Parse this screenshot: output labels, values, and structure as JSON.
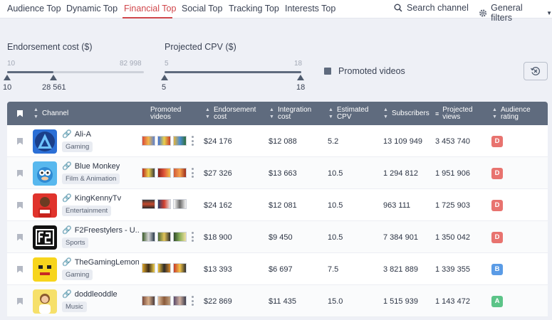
{
  "nav": {
    "tabs": [
      "Audience Top",
      "Dynamic Top",
      "Financial Top",
      "Social Top",
      "Tracking Top",
      "Interests Top"
    ],
    "active_tab": "Financial Top",
    "search_placeholder": "Search channel",
    "filters_label": "General filters"
  },
  "sliders": {
    "endorsement": {
      "title": "Endorsement cost ($)",
      "min": "10",
      "max": "82 998",
      "low": "10",
      "high": "28 561"
    },
    "cpv": {
      "title": "Projected CPV ($)",
      "min": "5",
      "max": "18",
      "low": "5",
      "high": "18"
    }
  },
  "promoted": {
    "label": "Promoted videos",
    "checked": true
  },
  "table": {
    "headers": {
      "channel": "Channel",
      "promoted_1": "Promoted",
      "promoted_2": "videos",
      "endorsement_1": "Endorsement",
      "endorsement_2": "cost",
      "integration_1": "Integration",
      "integration_2": "cost",
      "cpv_1": "Estimated",
      "cpv_2": "CPV",
      "subscribers": "Subscribers",
      "views_1": "Projected",
      "views_2": "views",
      "rating_1": "Audience",
      "rating_2": "rating"
    },
    "rows": [
      {
        "name": "Ali-A",
        "category": "Gaming",
        "endorsement": "$24 176",
        "integration": "$12 088",
        "cpv": "5.2",
        "subscribers": "13 109 949",
        "views": "3 453 740",
        "rating": "D"
      },
      {
        "name": "Blue Monkey",
        "category": "Film & Animation",
        "endorsement": "$27 326",
        "integration": "$13 663",
        "cpv": "10.5",
        "subscribers": "1 294 812",
        "views": "1 951 906",
        "rating": "D"
      },
      {
        "name": "KingKennyTv",
        "category": "Entertainment",
        "endorsement": "$24 162",
        "integration": "$12 081",
        "cpv": "10.5",
        "subscribers": "963 111",
        "views": "1 725 903",
        "rating": "D"
      },
      {
        "name": "F2Freestylers - U...",
        "category": "Sports",
        "endorsement": "$18 900",
        "integration": "$9 450",
        "cpv": "10.5",
        "subscribers": "7 384 901",
        "views": "1 350 042",
        "rating": "D"
      },
      {
        "name": "TheGamingLemon",
        "category": "Gaming",
        "endorsement": "$13 393",
        "integration": "$6 697",
        "cpv": "7.5",
        "subscribers": "3 821 889",
        "views": "1 339 355",
        "rating": "B"
      },
      {
        "name": "doddleoddle",
        "category": "Music",
        "endorsement": "$22 869",
        "integration": "$11 435",
        "cpv": "15.0",
        "subscribers": "1 515 939",
        "views": "1 143 472",
        "rating": "A"
      }
    ]
  },
  "colors": {
    "accent": "#d0464b",
    "header": "#5f6b7e",
    "rating_D": "#e8736f",
    "rating_B": "#5a9be6",
    "rating_A": "#5cc488"
  }
}
